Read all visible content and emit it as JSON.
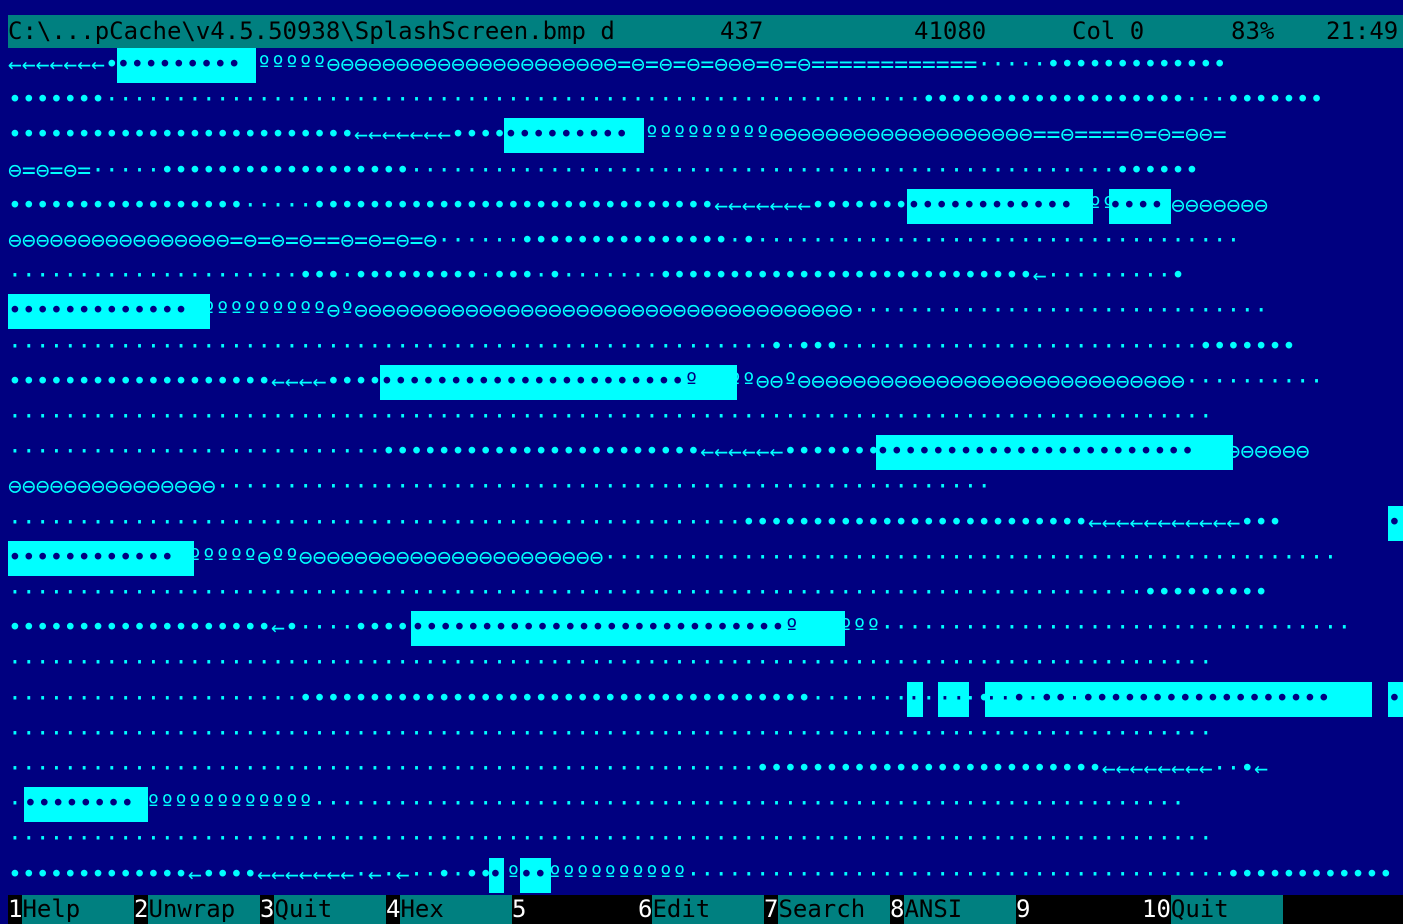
{
  "colors": {
    "background": "#000080",
    "text": "#00ffff",
    "highlight_bg": "#00ffff",
    "highlight_fg": "#000080",
    "status_bg": "#008080",
    "status_fg": "#000000",
    "keybar_bg": "#000000",
    "keynum_fg": "#ffffff"
  },
  "status": {
    "path": "C:\\...pCache\\v4.5.50938\\SplashScreen.bmp d",
    "size": "437",
    "offset": "41080",
    "column": "Col 0",
    "percent": "83%",
    "clock": "21:49"
  },
  "lines": [
    {
      "text": "←←←←←←←•••••••••ººººººº⊖⊖⊖⊖⊖⊖⊖⊖⊖⊖⊖⊖⊖⊖⊖⊖⊖⊖⊖⊖⊖=⊖=⊖=⊖=⊖⊖⊖=⊖=⊖============·····•••••••••••••",
      "highlights": [
        [
          7,
          9
        ]
      ]
    },
    {
      "text": "•••••••···························································•••••••••••••••••••···•••••••",
      "highlights": []
    },
    {
      "text": "•••••••••••••••••••••••••←←←←←←←•••••••••ºººººººººººººº⊖⊖⊖⊖⊖⊖⊖⊖⊖⊖⊖⊖⊖⊖⊖⊖⊖⊖⊖==⊖====⊖=⊖=⊖⊖=",
      "highlights": [
        [
          32,
          9
        ]
      ]
    },
    {
      "text": "⊖=⊖=⊖=·····••••••••••••••••••···················································••••••",
      "highlights": []
    },
    {
      "text": "•••••••••••••••••·····•••••••••••••••••••••••••••••←←←←←←←••••••••••••º••••ººººº⊖⊖⊖⊖⊖⊖⊖⊖⊖⊖⊖",
      "highlights": [
        [
          58,
          12
        ],
        [
          71,
          4
        ]
      ]
    },
    {
      "text": "⊖⊖⊖⊖⊖⊖⊖⊖⊖⊖⊖⊖⊖⊖⊖⊖=⊖=⊖=⊖==⊖=⊖=⊖=⊖······•••••••••••••••·•···································",
      "highlights": []
    },
    {
      "text": "·····················•••·•••••••••·•••·•·······•••••••••••••••••••••••••••←·········•",
      "highlights": [
        [
          91,
          1
        ]
      ]
    },
    {
      "text": "•••••••••••••ºººººººººº⊖º⊖⊖⊖⊖⊖⊖⊖⊖⊖⊖⊖⊖⊖⊖⊖⊖⊖⊖⊖⊖⊖⊖⊖⊖⊖⊖⊖⊖⊖⊖⊖⊖⊖⊖⊖⊖······························",
      "highlights": [
        [
          0,
          13
        ]
      ]
    },
    {
      "text": "·······················································•·•••··························•••••••",
      "highlights": []
    },
    {
      "text": "•••••••••••••••••••←←←←•••••••••••••••••••••••ºººººººº⊖⊖º⊖⊖⊖⊖⊖⊖⊖⊖⊖⊖⊖⊖⊖⊖⊖⊖⊖⊖⊖⊖⊖⊖⊖⊖⊖⊖⊖⊖··········",
      "highlights": [
        [
          24,
          23
        ]
      ]
    },
    {
      "text": "·······················································································",
      "highlights": []
    },
    {
      "text": "···························•••••••••••••••••••••••←←←←←←••••••••••••••••••••••••⊖⊖⊖⊖⊖⊖⊖⊖⊖⊖⊖⊖⊖⊖",
      "highlights": [
        [
          56,
          23
        ]
      ]
    },
    {
      "text": "⊖⊖⊖⊖⊖⊖⊖⊖⊖⊖⊖⊖⊖⊖⊖························································",
      "highlights": []
    },
    {
      "text": "·····················································•••••••••••••••••••••••••←←←←←←←←←←←•••",
      "highlights": [
        [
          89,
          3
        ]
      ]
    },
    {
      "text": "••••••••••••ºººººº⊖ºº⊖⊖⊖⊖⊖⊖⊖⊖⊖⊖⊖⊖⊖⊖⊖⊖⊖⊖⊖⊖⊖⊖·····················································",
      "highlights": [
        [
          0,
          12
        ]
      ]
    },
    {
      "text": "··················································································•••••••••",
      "highlights": []
    },
    {
      "text": "•••••••••••••••••••←•····••••••••••••••••••••••••••••ºººººººººº··································",
      "highlights": [
        [
          26,
          28
        ]
      ]
    },
    {
      "text": "·······················································································",
      "highlights": []
    },
    {
      "text": "·····················•••••••••••••••••••••••••••••••••••••·······•·••·••••••••••••••••••••••••ºº··",
      "highlights": [
        [
          58,
          1
        ],
        [
          60,
          2
        ],
        [
          63,
          25
        ],
        [
          89,
          1
        ]
      ]
    },
    {
      "text": "·······················································································",
      "highlights": []
    },
    {
      "text": "······················································•••••••••••••••••••••••••←←←←←←←←··•←",
      "highlights": [
        [
          90,
          1
        ]
      ]
    },
    {
      "text": "·••••••••·ºººººººººººº·······························································",
      "highlights": [
        [
          1,
          8
        ]
      ]
    },
    {
      "text": "·······················································································",
      "highlights": []
    },
    {
      "text": "•••••••••••••←••••←←←←←←←·←·←··•·••ºººººººººººººº·······································••••••••••••",
      "highlights": [
        [
          31,
          1
        ],
        [
          33,
          2
        ]
      ]
    }
  ],
  "keybar": [
    {
      "num": "1",
      "label": "Help"
    },
    {
      "num": "2",
      "label": "Unwrap"
    },
    {
      "num": "3",
      "label": "Quit"
    },
    {
      "num": "4",
      "label": "Hex"
    },
    {
      "num": "5",
      "label": ""
    },
    {
      "num": "6",
      "label": "Edit"
    },
    {
      "num": "7",
      "label": "Search"
    },
    {
      "num": "8",
      "label": "ANSI"
    },
    {
      "num": "9",
      "label": ""
    },
    {
      "num": "10",
      "label": "Quit"
    }
  ]
}
